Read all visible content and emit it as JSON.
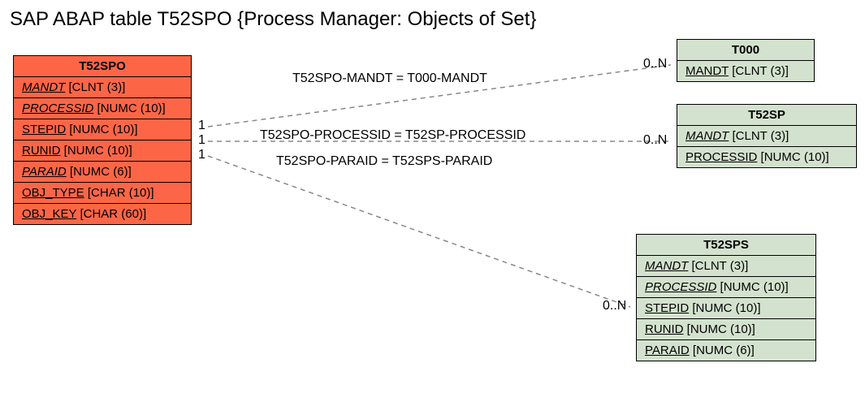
{
  "title": "SAP ABAP table T52SPO {Process Manager: Objects of Set}",
  "entities": {
    "t52spo": {
      "name": "T52SPO",
      "fields": [
        {
          "name": "MANDT",
          "type": "[CLNT (3)]",
          "italic": true
        },
        {
          "name": "PROCESSID",
          "type": "[NUMC (10)]",
          "italic": true
        },
        {
          "name": "STEPID",
          "type": "[NUMC (10)]",
          "italic": false
        },
        {
          "name": "RUNID",
          "type": "[NUMC (10)]",
          "italic": false
        },
        {
          "name": "PARAID",
          "type": "[NUMC (6)]",
          "italic": true
        },
        {
          "name": "OBJ_TYPE",
          "type": "[CHAR (10)]",
          "italic": false
        },
        {
          "name": "OBJ_KEY",
          "type": "[CHAR (60)]",
          "italic": false
        }
      ]
    },
    "t000": {
      "name": "T000",
      "fields": [
        {
          "name": "MANDT",
          "type": "[CLNT (3)]",
          "italic": false
        }
      ]
    },
    "t52sp": {
      "name": "T52SP",
      "fields": [
        {
          "name": "MANDT",
          "type": "[CLNT (3)]",
          "italic": true
        },
        {
          "name": "PROCESSID",
          "type": "[NUMC (10)]",
          "italic": false
        }
      ]
    },
    "t52sps": {
      "name": "T52SPS",
      "fields": [
        {
          "name": "MANDT",
          "type": "[CLNT (3)]",
          "italic": true
        },
        {
          "name": "PROCESSID",
          "type": "[NUMC (10)]",
          "italic": true
        },
        {
          "name": "STEPID",
          "type": "[NUMC (10)]",
          "italic": false
        },
        {
          "name": "RUNID",
          "type": "[NUMC (10)]",
          "italic": false
        },
        {
          "name": "PARAID",
          "type": "[NUMC (6)]",
          "italic": false
        }
      ]
    }
  },
  "relations": {
    "r1": {
      "label": "T52SPO-MANDT = T000-MANDT",
      "leftCard": "1",
      "rightCard": "0..N"
    },
    "r2": {
      "label": "T52SPO-PROCESSID = T52SP-PROCESSID",
      "leftCard": "1",
      "rightCard": "0..N"
    },
    "r3": {
      "label": "T52SPO-PARAID = T52SPS-PARAID",
      "leftCard": "1",
      "rightCard": "0..N"
    }
  }
}
